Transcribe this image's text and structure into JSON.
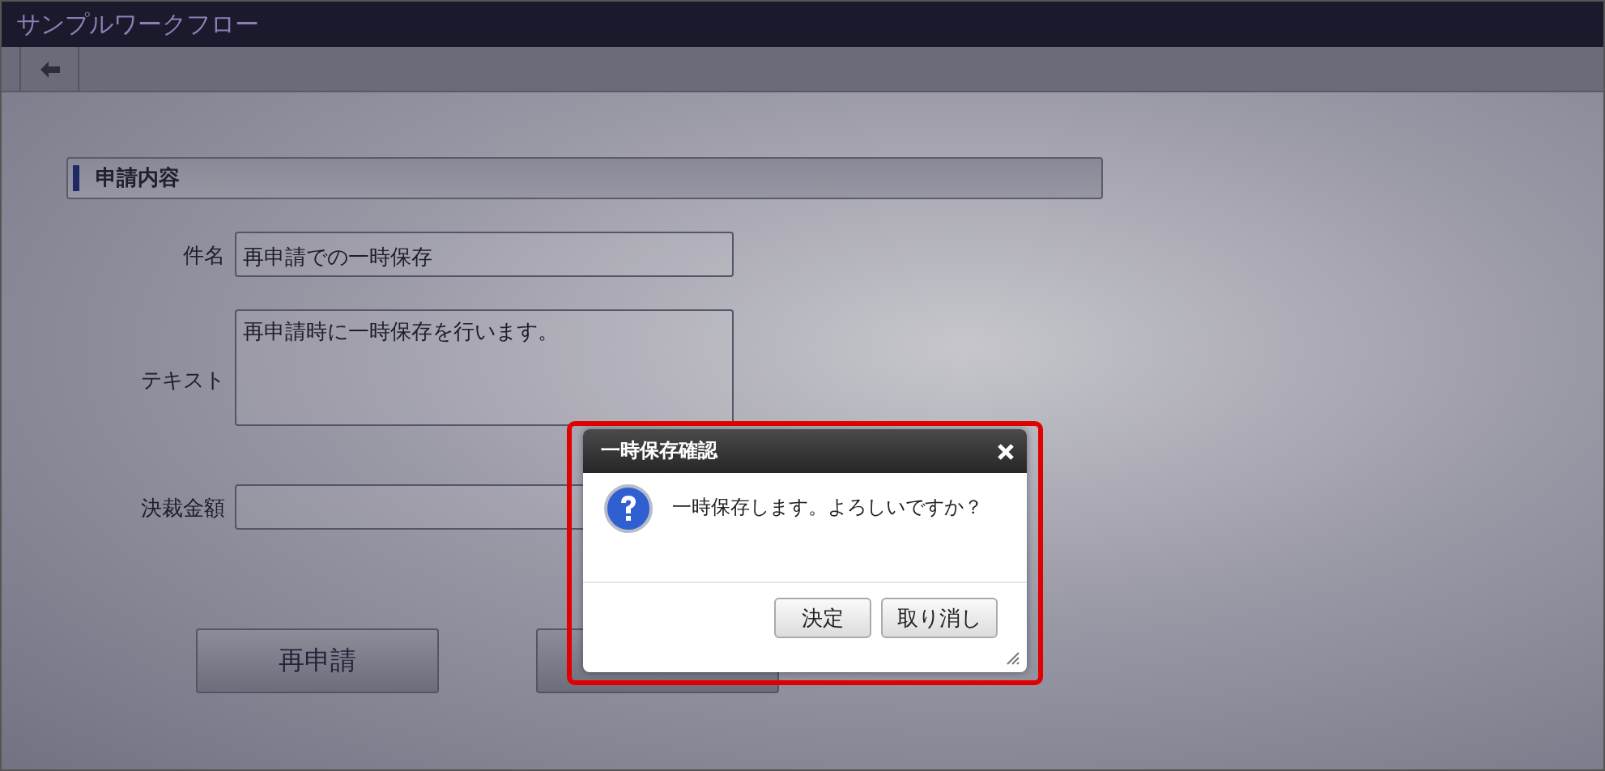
{
  "window": {
    "title": "サンプルワークフロー"
  },
  "section": {
    "title": "申請内容"
  },
  "fields": [
    {
      "label": "件名",
      "value": "再申請での一時保存",
      "kind": "input"
    },
    {
      "label": "テキスト",
      "value": "再申請時に一時保存を行います。",
      "kind": "textarea"
    },
    {
      "label": "決裁金額",
      "kind": "input"
    }
  ],
  "buttons": [
    "再申請"
  ],
  "dialog": {
    "title": "一時保存確認",
    "message": "一時保存します。よろしいですか？",
    "buttons": [
      "決定",
      "取り消し"
    ],
    "highlighted": true
  }
}
